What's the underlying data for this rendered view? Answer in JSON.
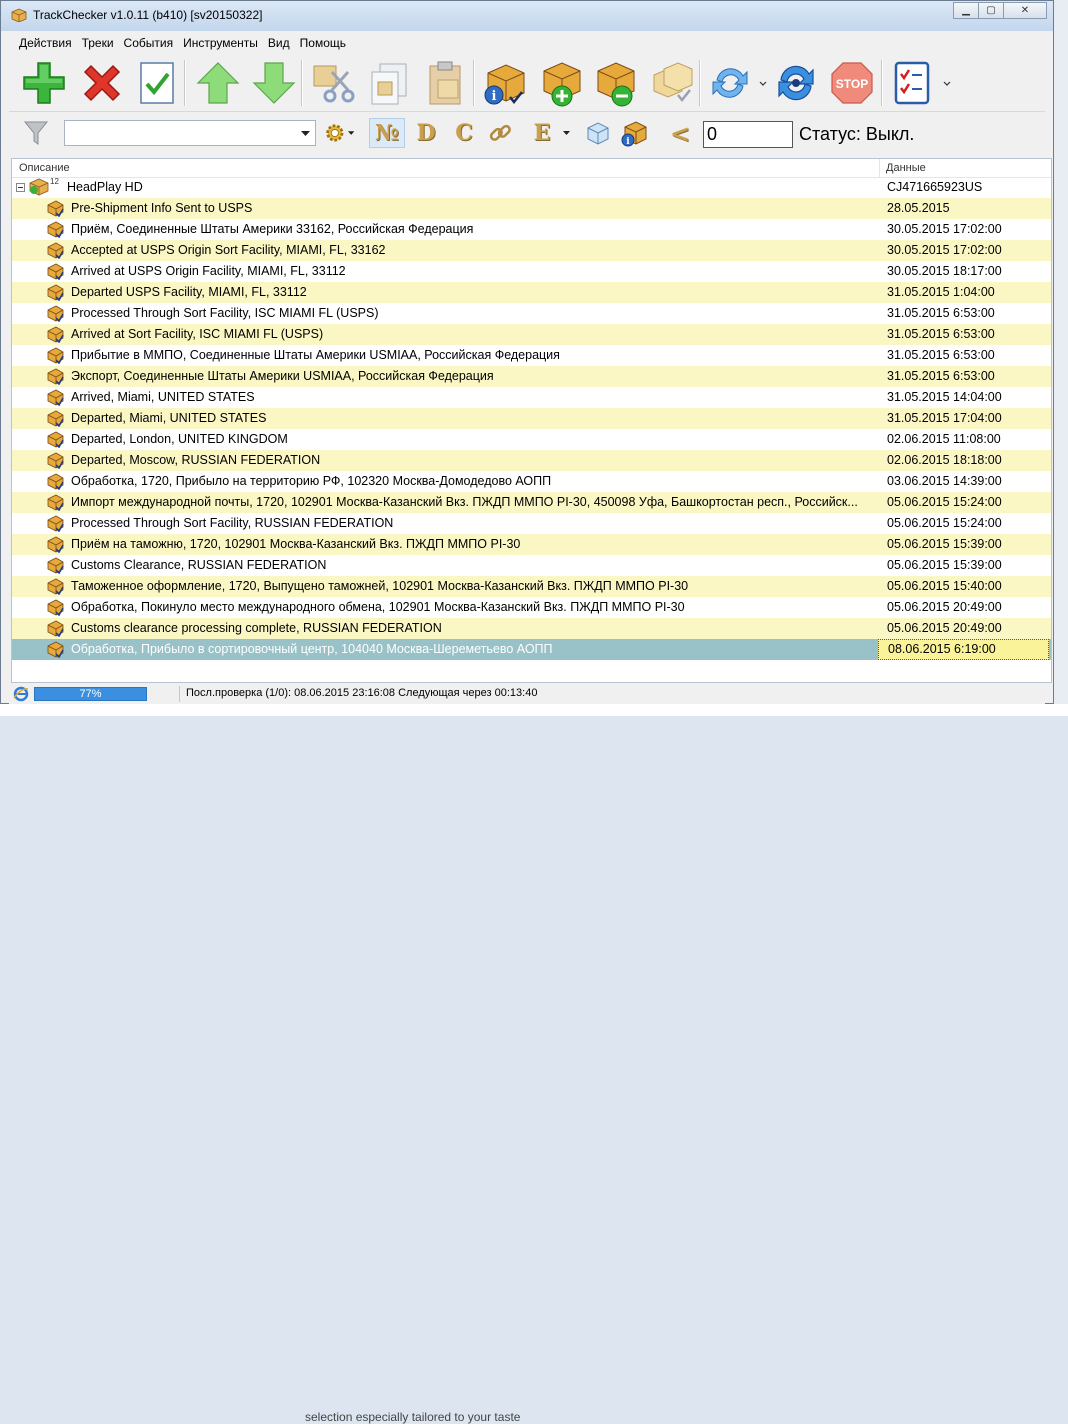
{
  "window": {
    "title": "TrackChecker v1.0.11 (b410)  [sv20150322]"
  },
  "menu": [
    "Действия",
    "Треки",
    "События",
    "Инструменты",
    "Вид",
    "Помощь"
  ],
  "filter": {
    "combo_value": "",
    "number_glyph": "№",
    "letter_d": "D",
    "letter_c": "C",
    "letter_e": "E",
    "comparison": "<",
    "count_value": "0",
    "status_text": "Статус: Выкл."
  },
  "grid": {
    "col_description": "Описание",
    "col_data": "Данные",
    "root": {
      "label": "HeadPlay HD",
      "count": "12",
      "value": "CJ471665923US"
    },
    "rows": [
      {
        "desc": "Pre-Shipment Info Sent to USPS",
        "val": "28.05.2015"
      },
      {
        "desc": "Приём, Соединенные Штаты Америки 33162, Российская Федерация",
        "val": "30.05.2015 17:02:00"
      },
      {
        "desc": "Accepted at USPS Origin Sort Facility, MIAMI, FL, 33162",
        "val": "30.05.2015 17:02:00"
      },
      {
        "desc": "Arrived at USPS Origin Facility, MIAMI, FL, 33112",
        "val": "30.05.2015 18:17:00"
      },
      {
        "desc": "Departed USPS Facility, MIAMI, FL, 33112",
        "val": "31.05.2015 1:04:00"
      },
      {
        "desc": "Processed Through Sort Facility, ISC MIAMI FL (USPS)",
        "val": "31.05.2015 6:53:00"
      },
      {
        "desc": "Arrived at Sort Facility, ISC MIAMI FL (USPS)",
        "val": "31.05.2015 6:53:00"
      },
      {
        "desc": "Прибытие в ММПО, Соединенные Штаты Америки USMIAA, Российская Федерация",
        "val": "31.05.2015 6:53:00"
      },
      {
        "desc": "Экспорт, Соединенные Штаты Америки USMIAA, Российская Федерация",
        "val": "31.05.2015 6:53:00"
      },
      {
        "desc": "Arrived, Miami, UNITED STATES",
        "val": "31.05.2015 14:04:00"
      },
      {
        "desc": "Departed, Miami, UNITED STATES",
        "val": "31.05.2015 17:04:00"
      },
      {
        "desc": "Departed, London, UNITED KINGDOM",
        "val": "02.06.2015 11:08:00"
      },
      {
        "desc": "Departed, Moscow, RUSSIAN FEDERATION",
        "val": "02.06.2015 18:18:00"
      },
      {
        "desc": "Обработка, 1720, Прибыло на территорию РФ, 102320 Москва-Домодедово АОПП",
        "val": "03.06.2015 14:39:00"
      },
      {
        "desc": "Импорт международной почты, 1720, 102901 Москва-Казанский Вкз. ПЖДП ММПО PI-30, 450098 Уфа, Башкортостан респ., Российск...",
        "val": "05.06.2015 15:24:00"
      },
      {
        "desc": "Processed Through Sort Facility, RUSSIAN FEDERATION",
        "val": "05.06.2015 15:24:00"
      },
      {
        "desc": "Приём на таможню, 1720, 102901 Москва-Казанский Вкз. ПЖДП ММПО PI-30",
        "val": "05.06.2015 15:39:00"
      },
      {
        "desc": "Customs Clearance, RUSSIAN FEDERATION",
        "val": "05.06.2015 15:39:00"
      },
      {
        "desc": "Таможенное оформление, 1720, Выпущено таможней, 102901 Москва-Казанский Вкз. ПЖДП ММПО PI-30",
        "val": "05.06.2015 15:40:00"
      },
      {
        "desc": "Обработка, Покинуло место международного обмена, 102901 Москва-Казанский Вкз. ПЖДП ММПО PI-30",
        "val": "05.06.2015 20:49:00"
      },
      {
        "desc": "Customs clearance processing complete, RUSSIAN FEDERATION",
        "val": "05.06.2015 20:49:00"
      },
      {
        "desc": "Обработка, Прибыло в сортировочный центр, 104040 Москва-Шереметьево АОПП",
        "val": "08.06.2015 6:19:00",
        "selected": true
      }
    ]
  },
  "statusbar": {
    "progress_percent": 77,
    "progress_label": "77%",
    "text": "Посл.проверка (1/0): 08.06.2015 23:16:08 Следующая через  00:13:40"
  },
  "background": {
    "bottom_text": "selection especially tailored to your taste"
  },
  "colors": {
    "alt_row": "#fbf7c4",
    "selected_row": "#99c1c8",
    "selected_cell": "#fbf39a",
    "progress": "#3a8fe0"
  },
  "icons": [
    "app-box-icon",
    "add-icon",
    "delete-icon",
    "check-icon",
    "arrow-up-icon",
    "arrow-down-icon",
    "cut-icon",
    "copy-icon",
    "paste-icon",
    "box-info-icon",
    "box-add-icon",
    "box-remove-icon",
    "boxes-check-icon",
    "refresh-icon",
    "refresh-all-icon",
    "stop-icon",
    "checklist-icon",
    "filter-icon",
    "gear-icon",
    "chain-icon",
    "cube-icon",
    "box-info-small-icon",
    "ie-icon"
  ]
}
